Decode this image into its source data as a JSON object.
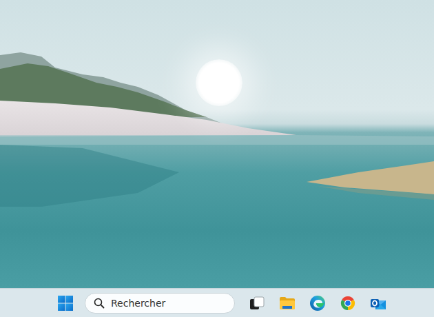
{
  "taskbar": {
    "search": {
      "placeholder": "Rechercher"
    },
    "apps": [
      {
        "kind": "start"
      },
      {
        "kind": "search"
      },
      {
        "kind": "taskview"
      },
      {
        "kind": "explorer"
      },
      {
        "kind": "edge"
      },
      {
        "kind": "chrome"
      },
      {
        "kind": "outlook"
      }
    ]
  }
}
